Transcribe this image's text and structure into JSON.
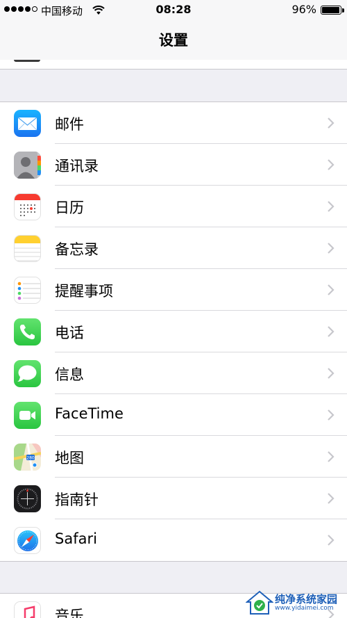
{
  "status_bar": {
    "carrier": "中国移动",
    "time": "08:28",
    "battery_percent": "96%",
    "battery_level": 0.96,
    "signal_bars_filled": 4,
    "signal_bars_total": 5
  },
  "nav": {
    "title": "设置"
  },
  "groups": [
    {
      "items": [
        {
          "id": "mail",
          "label": "邮件",
          "icon": "mail-icon"
        },
        {
          "id": "contacts",
          "label": "通讯录",
          "icon": "contacts-icon"
        },
        {
          "id": "calendar",
          "label": "日历",
          "icon": "calendar-icon"
        },
        {
          "id": "notes",
          "label": "备忘录",
          "icon": "notes-icon"
        },
        {
          "id": "reminders",
          "label": "提醒事项",
          "icon": "reminders-icon"
        },
        {
          "id": "phone",
          "label": "电话",
          "icon": "phone-icon"
        },
        {
          "id": "messages",
          "label": "信息",
          "icon": "messages-icon"
        },
        {
          "id": "facetime",
          "label": "FaceTime",
          "icon": "facetime-icon"
        },
        {
          "id": "maps",
          "label": "地图",
          "icon": "maps-icon"
        },
        {
          "id": "compass",
          "label": "指南针",
          "icon": "compass-icon"
        },
        {
          "id": "safari",
          "label": "Safari",
          "icon": "safari-icon"
        }
      ]
    },
    {
      "items": [
        {
          "id": "music",
          "label": "音乐",
          "icon": "music-icon"
        }
      ]
    }
  ],
  "watermark": {
    "text": "纯净系统家园",
    "url": "www.yidaimei.com"
  },
  "colors": {
    "background": "#efeff4",
    "separator": "#c8c7cc",
    "chevron": "#c7c7cc",
    "phone_green": "#4cd964",
    "mail_blue": "#1e8ff5",
    "notes_yellow": "#ffd030"
  }
}
